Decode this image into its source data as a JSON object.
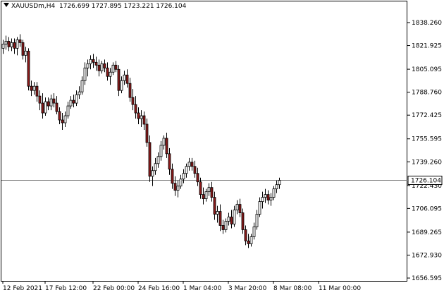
{
  "header": {
    "symbol": "XAUUSDm,H4",
    "ohlc": "1726.699 1727.895 1723.221 1726.104"
  },
  "colors": {
    "background": "#ffffff",
    "bull_candle": "#ffffff",
    "bear_candle": "#8b1a1a",
    "wick": "#000000",
    "price_line": "#808080",
    "price_label_bg": "#ffffff"
  },
  "chart_data": {
    "type": "candlestick",
    "title": "",
    "xlabel": "",
    "ylabel": "",
    "ylim": [
      1653,
      1850
    ],
    "grid": false,
    "current_price": 1726.104,
    "current_price_label": "1726.104",
    "y_ticks": [
      "1838.260",
      "1821.925",
      "1805.095",
      "1788.760",
      "1772.425",
      "1755.595",
      "1739.260",
      "1722.430",
      "1706.095",
      "1689.265",
      "1672.930",
      "1656.595"
    ],
    "x_tick_labels": [
      "12 Feb 2021",
      "17 Feb 12:00",
      "22 Feb 00:00",
      "24 Feb 16:00",
      "1 Mar 04:00",
      "3 Mar 20:00",
      "8 Mar 08:00",
      "11 Mar 00:00"
    ],
    "x_tick_candle_index": [
      0,
      15,
      32,
      48,
      64,
      80,
      96,
      112
    ],
    "candles": [
      [
        1820,
        1826,
        1816,
        1823
      ],
      [
        1823,
        1829,
        1819,
        1825
      ],
      [
        1825,
        1828,
        1818,
        1821
      ],
      [
        1821,
        1827,
        1818,
        1824
      ],
      [
        1824,
        1827,
        1816,
        1820
      ],
      [
        1820,
        1828,
        1815,
        1826
      ],
      [
        1826,
        1830,
        1821,
        1824
      ],
      [
        1824,
        1826,
        1812,
        1815
      ],
      [
        1815,
        1821,
        1810,
        1818
      ],
      [
        1818,
        1820,
        1790,
        1793
      ],
      [
        1793,
        1797,
        1786,
        1790
      ],
      [
        1790,
        1796,
        1787,
        1793
      ],
      [
        1793,
        1796,
        1782,
        1786
      ],
      [
        1786,
        1790,
        1776,
        1781
      ],
      [
        1781,
        1788,
        1770,
        1774
      ],
      [
        1774,
        1785,
        1772,
        1782
      ],
      [
        1782,
        1785,
        1776,
        1779
      ],
      [
        1779,
        1787,
        1776,
        1784
      ],
      [
        1784,
        1788,
        1778,
        1781
      ],
      [
        1781,
        1786,
        1773,
        1775
      ],
      [
        1775,
        1778,
        1766,
        1769
      ],
      [
        1769,
        1774,
        1762,
        1767
      ],
      [
        1767,
        1775,
        1764,
        1772
      ],
      [
        1772,
        1782,
        1770,
        1779
      ],
      [
        1779,
        1786,
        1777,
        1783
      ],
      [
        1783,
        1787,
        1778,
        1781
      ],
      [
        1781,
        1790,
        1779,
        1787
      ],
      [
        1787,
        1793,
        1784,
        1789
      ],
      [
        1789,
        1800,
        1787,
        1797
      ],
      [
        1797,
        1810,
        1794,
        1806
      ],
      [
        1806,
        1812,
        1800,
        1809
      ],
      [
        1809,
        1815,
        1805,
        1812
      ],
      [
        1812,
        1816,
        1806,
        1810
      ],
      [
        1810,
        1814,
        1804,
        1808
      ],
      [
        1808,
        1812,
        1800,
        1804
      ],
      [
        1804,
        1811,
        1802,
        1809
      ],
      [
        1809,
        1812,
        1803,
        1806
      ],
      [
        1806,
        1810,
        1797,
        1800
      ],
      [
        1800,
        1806,
        1794,
        1803
      ],
      [
        1803,
        1810,
        1801,
        1808
      ],
      [
        1808,
        1811,
        1803,
        1805
      ],
      [
        1805,
        1808,
        1786,
        1790
      ],
      [
        1790,
        1800,
        1788,
        1797
      ],
      [
        1797,
        1804,
        1794,
        1801
      ],
      [
        1801,
        1805,
        1792,
        1795
      ],
      [
        1795,
        1799,
        1782,
        1785
      ],
      [
        1785,
        1791,
        1776,
        1780
      ],
      [
        1780,
        1786,
        1770,
        1774
      ],
      [
        1774,
        1778,
        1766,
        1770
      ],
      [
        1770,
        1776,
        1764,
        1772
      ],
      [
        1772,
        1775,
        1762,
        1766
      ],
      [
        1766,
        1770,
        1750,
        1753
      ],
      [
        1753,
        1758,
        1725,
        1729
      ],
      [
        1729,
        1736,
        1722,
        1733
      ],
      [
        1733,
        1742,
        1730,
        1738
      ],
      [
        1738,
        1746,
        1735,
        1743
      ],
      [
        1743,
        1754,
        1740,
        1751
      ],
      [
        1751,
        1758,
        1748,
        1756
      ],
      [
        1756,
        1760,
        1742,
        1745
      ],
      [
        1745,
        1749,
        1730,
        1734
      ],
      [
        1734,
        1738,
        1720,
        1724
      ],
      [
        1724,
        1729,
        1715,
        1719
      ],
      [
        1719,
        1726,
        1714,
        1722
      ],
      [
        1722,
        1730,
        1720,
        1727
      ],
      [
        1727,
        1734,
        1724,
        1731
      ],
      [
        1731,
        1738,
        1728,
        1736
      ],
      [
        1736,
        1742,
        1733,
        1739
      ],
      [
        1739,
        1742,
        1733,
        1736
      ],
      [
        1736,
        1740,
        1728,
        1731
      ],
      [
        1731,
        1735,
        1722,
        1725
      ],
      [
        1725,
        1728,
        1713,
        1716
      ],
      [
        1716,
        1721,
        1709,
        1713
      ],
      [
        1713,
        1720,
        1711,
        1718
      ],
      [
        1718,
        1724,
        1715,
        1721
      ],
      [
        1721,
        1725,
        1711,
        1714
      ],
      [
        1714,
        1718,
        1698,
        1702
      ],
      [
        1702,
        1708,
        1696,
        1704
      ],
      [
        1704,
        1709,
        1690,
        1694
      ],
      [
        1694,
        1698,
        1688,
        1691
      ],
      [
        1691,
        1699,
        1689,
        1697
      ],
      [
        1697,
        1703,
        1694,
        1700
      ],
      [
        1700,
        1705,
        1692,
        1695
      ],
      [
        1695,
        1708,
        1693,
        1705
      ],
      [
        1705,
        1712,
        1702,
        1709
      ],
      [
        1709,
        1713,
        1700,
        1703
      ],
      [
        1703,
        1706,
        1688,
        1691
      ],
      [
        1691,
        1694,
        1680,
        1683
      ],
      [
        1683,
        1688,
        1678,
        1681
      ],
      [
        1681,
        1688,
        1679,
        1686
      ],
      [
        1686,
        1696,
        1684,
        1693
      ],
      [
        1693,
        1705,
        1691,
        1702
      ],
      [
        1702,
        1714,
        1700,
        1711
      ],
      [
        1711,
        1718,
        1706,
        1714
      ],
      [
        1714,
        1720,
        1710,
        1716
      ],
      [
        1716,
        1719,
        1709,
        1712
      ],
      [
        1712,
        1717,
        1708,
        1714
      ],
      [
        1714,
        1722,
        1712,
        1720
      ],
      [
        1720,
        1726,
        1717,
        1723
      ],
      [
        1723,
        1728,
        1720,
        1726
      ]
    ]
  }
}
